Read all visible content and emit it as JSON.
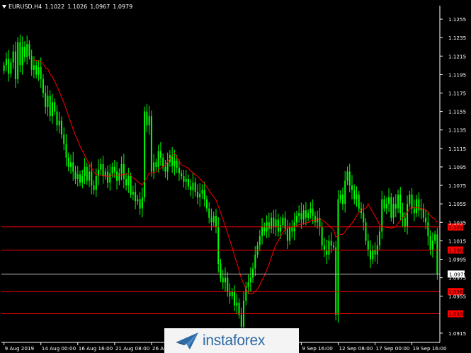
{
  "header": {
    "symbol": "EURUSD,H4",
    "ohlc": [
      "1.1022",
      "1.1026",
      "1.0967",
      "1.0979"
    ]
  },
  "colors": {
    "background": "#000000",
    "candle": "#00ff00",
    "moving_average": "#ff0000",
    "level_lines": "#ff0000",
    "price_line": "#c0c0c0",
    "axis_text": "#ffffff"
  },
  "icons": {
    "watermark_logo": "paper-plane-icon"
  },
  "watermark": {
    "text": "instaforex"
  },
  "chart_data": {
    "type": "candlestick",
    "instrument": "EURUSD",
    "timeframe": "H4",
    "ylim": [
      1.0905,
      1.1265
    ],
    "grid": false,
    "y_ticks": [
      "1.1255",
      "1.1235",
      "1.1215",
      "1.1195",
      "1.1175",
      "1.1155",
      "1.1135",
      "1.1115",
      "1.1095",
      "1.1075",
      "1.1055",
      "1.1035",
      "1.1015",
      "1.0995",
      "1.0975",
      "1.0955",
      "1.0915"
    ],
    "x_ticks": [
      {
        "label": "9 Aug 2019",
        "index": 0
      },
      {
        "label": "14 Aug 00:00",
        "index": 16
      },
      {
        "label": "16 Aug 16:00",
        "index": 32
      },
      {
        "label": "21 Aug 08:00",
        "index": 48
      },
      {
        "label": "26 Aug",
        "index": 64
      },
      {
        "label": "9 Sep 16:00",
        "index": 129
      },
      {
        "label": "12 Sep 08:00",
        "index": 145
      },
      {
        "label": "17 Sep 00:00",
        "index": 161
      },
      {
        "label": "19 Sep 16:00",
        "index": 177
      }
    ],
    "current_price": {
      "value": 1.0979,
      "label": "1.0979"
    },
    "levels": [
      {
        "value": 1.103,
        "label": "1.1030"
      },
      {
        "value": 1.1005,
        "label": "1.1005"
      },
      {
        "value": 1.096,
        "label": "1.0960"
      },
      {
        "value": 1.0936,
        "label": "1.0936"
      }
    ],
    "close": [
      1.1205,
      1.1212,
      1.1196,
      1.1208,
      1.122,
      1.119,
      1.123,
      1.1205,
      1.1225,
      1.1214,
      1.1228,
      1.1215,
      1.12,
      1.1205,
      1.1195,
      1.1203,
      1.119,
      1.1175,
      1.116,
      1.1172,
      1.115,
      1.1165,
      1.1155,
      1.114,
      1.1145,
      1.113,
      1.112,
      1.1105,
      1.1095,
      1.11,
      1.109,
      1.1082,
      1.1087,
      1.1078,
      1.1085,
      1.1095,
      1.108,
      1.109,
      1.1075,
      1.107,
      1.1085,
      1.1092,
      1.1098,
      1.1085,
      1.109,
      1.1078,
      1.1088,
      1.1095,
      1.109,
      1.108,
      1.1088,
      1.1098,
      1.1082,
      1.1075,
      1.1085,
      1.1065,
      1.1068,
      1.1058,
      1.106,
      1.105,
      1.1062,
      1.1155,
      1.114,
      1.115,
      1.109,
      1.11,
      1.1095,
      1.1112,
      1.1105,
      1.1095,
      1.109,
      1.11,
      1.1108,
      1.1096,
      1.1102,
      1.1094,
      1.1088,
      1.1085,
      1.1079,
      1.1082,
      1.1074,
      1.107,
      1.1078,
      1.1068,
      1.1062,
      1.1066,
      1.107,
      1.106,
      1.105,
      1.104,
      1.1035,
      1.1042,
      1.103,
      1.099,
      1.0975,
      1.097,
      1.0975,
      1.096,
      1.0955,
      1.096,
      1.0945,
      1.0948,
      1.0935,
      1.0922,
      1.095,
      1.0965,
      1.097,
      1.0975,
      1.0985,
      1.1,
      1.101,
      1.102,
      1.103,
      1.1025,
      1.1035,
      1.1028,
      1.104,
      1.103,
      1.1038,
      1.1025,
      1.1032,
      1.104,
      1.1028,
      1.1015,
      1.103,
      1.1025,
      1.1035,
      1.1042,
      1.1045,
      1.1038,
      1.1048,
      1.104,
      1.1045,
      1.105,
      1.1042,
      1.1035,
      1.104,
      1.103,
      1.101,
      1.1005,
      1.1,
      1.1015,
      1.101,
      1.1008,
      1.0935,
      1.106,
      1.1065,
      1.1055,
      1.108,
      1.109,
      1.1075,
      1.107,
      1.106,
      1.1065,
      1.105,
      1.1045,
      1.1035,
      1.1015,
      1.1005,
      1.0995,
      1.1005,
      1.1,
      1.101,
      1.1025,
      1.106,
      1.105,
      1.1055,
      1.1062,
      1.104,
      1.1055,
      1.105,
      1.1065,
      1.1045,
      1.104,
      1.103,
      1.1055,
      1.1065,
      1.105,
      1.1045,
      1.106,
      1.1048,
      1.105,
      1.104,
      1.1035,
      1.102,
      1.1005,
      1.1015,
      1.1022,
      1.0979
    ]
  }
}
